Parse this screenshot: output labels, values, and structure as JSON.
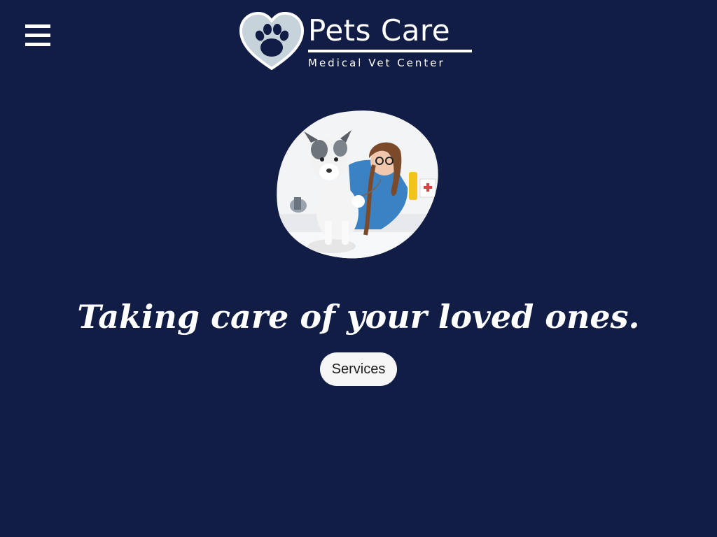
{
  "header": {
    "menu_icon": "hamburger-menu-icon",
    "logo": {
      "icon": "heart-paw-icon",
      "brand_name": "Pets Care",
      "tagline": "Medical Vet Center"
    }
  },
  "hero": {
    "image_subject": "veterinarian-with-dog",
    "title": "Taking care of your loved ones.",
    "services_label": "Services"
  },
  "colors": {
    "background": "#111d44",
    "text": "#ffffff",
    "button_background": "#f6f6f7",
    "button_text": "#1c1c1c",
    "logo_heart": "#c6d3da",
    "scrub_blue": "#3b82c4"
  }
}
